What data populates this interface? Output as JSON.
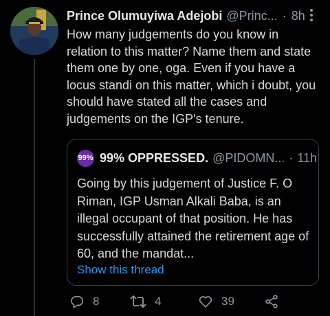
{
  "colors": {
    "background": "#000000",
    "text": "#d9d9d9",
    "muted": "#8b98a5",
    "link": "#1d9bf0",
    "border": "#3b4148",
    "quote_avatar": "#6a2ca3"
  },
  "tweet": {
    "display_name": "Prince Olumuyiwa Adejobi",
    "handle": "@Princ...",
    "dot": "·",
    "time": "8h",
    "more_icon": "more-vertical-icon",
    "text": "How many judgements do you know in relation to this matter? Name them and state them one by one, oga. Even if you have a locus standi on this matter, which i doubt, you should have stated all the cases and judgements on the IGP's tenure."
  },
  "quote": {
    "avatar_text": "99%",
    "display_name": "99% OPPRESSED.",
    "handle": "@PIDOMN...",
    "dot": "·",
    "time": "11h",
    "text": "Going by this judgement of Justice F. O Riman, IGP Usman Alkali Baba, is an illegal occupant of that position. He has successfully attained the retirement age of 60, and the mandat...",
    "show_thread": "Show this thread"
  },
  "actions": {
    "reply_count": "8",
    "retweet_count": "4",
    "like_count": "39"
  }
}
